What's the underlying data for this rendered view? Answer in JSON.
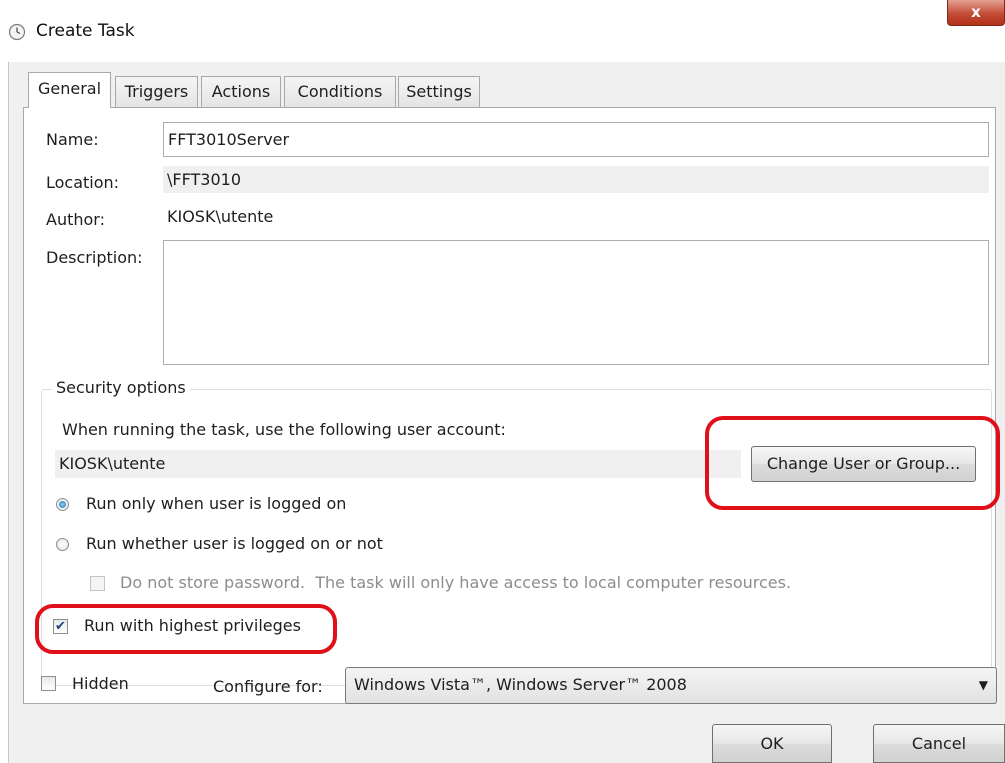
{
  "window": {
    "title": "Create Task",
    "close_glyph": "x",
    "icon": "clock-icon"
  },
  "tabs": [
    {
      "label": "General",
      "active": true
    },
    {
      "label": "Triggers",
      "active": false
    },
    {
      "label": "Actions",
      "active": false
    },
    {
      "label": "Conditions",
      "active": false
    },
    {
      "label": "Settings",
      "active": false
    }
  ],
  "general": {
    "name_label": "Name:",
    "name_value": "FFT3010Server",
    "location_label": "Location:",
    "location_value": "\\FFT3010",
    "author_label": "Author:",
    "author_value": "KIOSK\\utente",
    "description_label": "Description:",
    "description_value": ""
  },
  "security": {
    "legend": "Security options",
    "account_prompt": "When running the task, use the following user account:",
    "account_value": "KIOSK\\utente",
    "change_button": "Change User or Group...",
    "radio_logged_on": "Run only when user is logged on",
    "radio_logged_on_checked": true,
    "radio_whether": "Run whether user is logged on or not",
    "radio_whether_checked": false,
    "no_store_password": "Do not store password.  The task will only have access to local computer resources.",
    "no_store_password_checked": false,
    "highest_privileges": "Run with highest privileges",
    "highest_privileges_checked": true
  },
  "bottom": {
    "hidden_label": "Hidden",
    "hidden_checked": false,
    "configure_label": "Configure for:",
    "configure_value": "Windows Vista™, Windows Server™ 2008"
  },
  "buttons": {
    "ok": "OK",
    "cancel": "Cancel"
  },
  "colors": {
    "highlight": "#e0101a",
    "close_button": "#c44c36"
  }
}
